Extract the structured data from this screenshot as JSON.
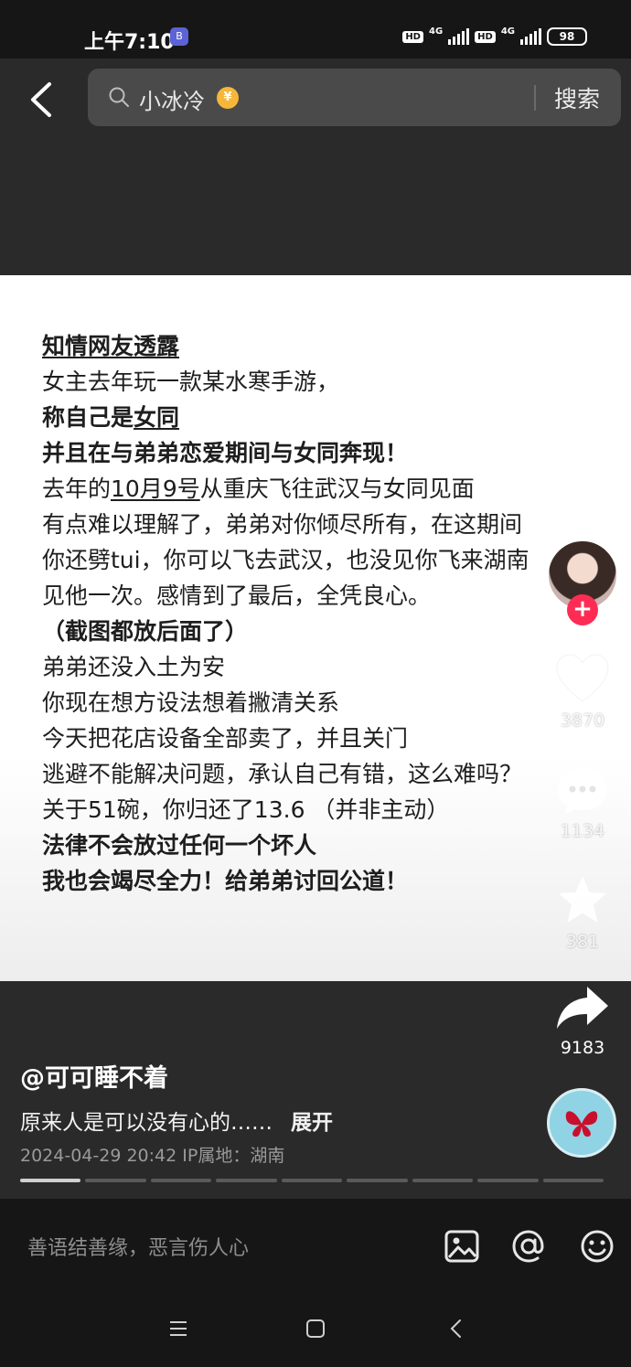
{
  "status_bar": {
    "time": "上午7:10",
    "app_badge": "B",
    "hd1": "HD",
    "net1": "4G",
    "hd2": "HD",
    "net2": "4G",
    "battery": "98"
  },
  "search": {
    "query": "小冰冷",
    "coin_symbol": "¥",
    "button_label": "搜索"
  },
  "post": {
    "lines": [
      {
        "text": "知情网友透露",
        "bold": true,
        "underline": true
      },
      {
        "text": "女主去年玩一款某水寒手游，",
        "bold": false
      },
      {
        "pre": "称自己是",
        "u": "女同",
        "bold": true
      },
      {
        "text": "并且在与弟弟恋爱期间与女同奔现！",
        "bold": true
      },
      {
        "pre": "去年的",
        "u": "10月9号",
        "post": "从重庆飞往武汉与女同见面",
        "bold": false
      },
      {
        "text": "有点难以理解了，弟弟对你倾尽所有，在这期间",
        "bold": false
      },
      {
        "text": "你还劈tui，你可以飞去武汉，也没见你飞来湖南",
        "bold": false
      },
      {
        "text": "见他一次。感情到了最后，全凭良心。",
        "bold": false
      },
      {
        "text": "（截图都放后面了）",
        "bold": true
      },
      {
        "text": "弟弟还没入土为安",
        "bold": false
      },
      {
        "text": "你现在想方设法想着撇清关系",
        "bold": false
      },
      {
        "text": "今天把花店设备全部卖了，并且关门",
        "bold": false
      },
      {
        "text": "逃避不能解决问题，承认自己有错，这么难吗？",
        "bold": false
      },
      {
        "text": "关于51碗，你归还了13.6 （并非主动）",
        "bold": false
      },
      {
        "text": "法律不会放过任何一个坏人",
        "bold": true
      },
      {
        "text": "我也会竭尽全力！给弟弟讨回公道！",
        "bold": true
      }
    ]
  },
  "rail": {
    "follow_symbol": "+",
    "likes": "3870",
    "comments": "1134",
    "favorites": "381",
    "shares": "9183"
  },
  "info": {
    "author": "@可可睡不着",
    "description": "原来人是可以没有心的……",
    "expand": "展开",
    "meta": "2024-04-29 20:42  IP属地：湖南",
    "progress_total": 9,
    "progress_active": 1
  },
  "comment_bar": {
    "placeholder": "善语结善缘，恶言伤人心"
  },
  "colors": {
    "accent": "#fe2c55",
    "background": "#161616",
    "panel": "#2a2a2a"
  },
  "icons": [
    "back-arrow-icon",
    "search-icon",
    "heart-icon",
    "comment-bubble-icon",
    "star-icon",
    "share-arrow-icon",
    "image-icon",
    "at-icon",
    "emoji-icon",
    "menu-icon",
    "home-square-icon",
    "back-triangle-icon"
  ]
}
